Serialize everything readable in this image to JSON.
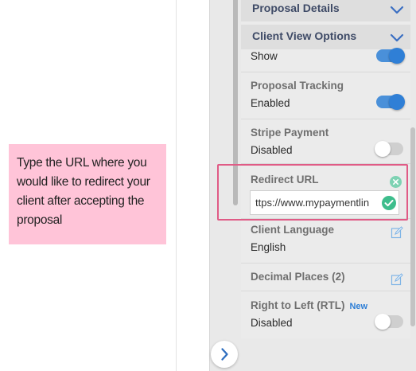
{
  "callout": {
    "text": "Type the URL where you would like to redirect your client after accepting the proposal"
  },
  "sidebar": {
    "sections": {
      "proposal_details": "Proposal Details",
      "client_view_options": "Client View Options"
    },
    "show_row": {
      "value": "Show",
      "enabled": true
    },
    "proposal_tracking": {
      "label": "Proposal Tracking",
      "value": "Enabled",
      "enabled": true
    },
    "stripe_payment": {
      "label": "Stripe Payment",
      "value": "Disabled",
      "enabled": false
    },
    "redirect_url": {
      "label": "Redirect URL",
      "value": "ttps://www.mypaymentlin"
    },
    "client_language": {
      "label": "Client Language",
      "value": "English"
    },
    "decimal_places": {
      "label": "Decimal Places (2)"
    },
    "right_to_left": {
      "label": "Right to Left (RTL)",
      "badge": "New",
      "value": "Disabled",
      "enabled": false
    }
  },
  "icons": {
    "chevron": "chevron-down-icon",
    "edit": "edit-icon",
    "check": "check-icon",
    "clear": "close-icon",
    "expand": "chevron-right-icon"
  },
  "colors": {
    "accent": "#2f7fd6",
    "highlight": "#e05b86",
    "callout_bg": "#ffc4d8",
    "success": "#3dbd8c"
  }
}
